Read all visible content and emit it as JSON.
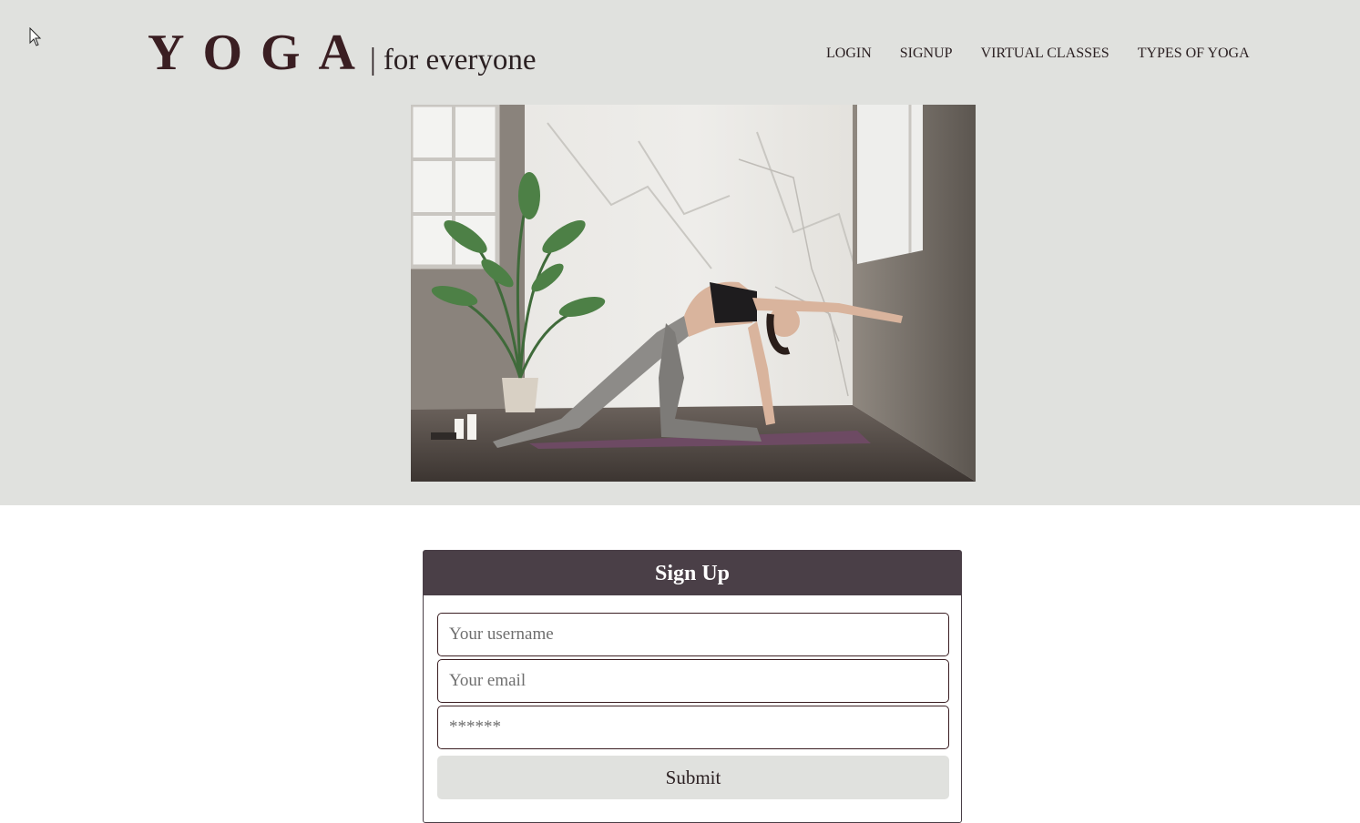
{
  "brand": {
    "name": "YOGA",
    "separator": "|",
    "tagline": "for everyone"
  },
  "nav": {
    "items": [
      {
        "label": "LOGIN"
      },
      {
        "label": "SIGNUP"
      },
      {
        "label": "VIRTUAL CLASSES"
      },
      {
        "label": "TYPES OF YOGA"
      }
    ]
  },
  "hero": {
    "image": "yoga-pose-photo"
  },
  "signup": {
    "title": "Sign Up",
    "username_placeholder": "Your username",
    "email_placeholder": "Your email",
    "password_placeholder": "******",
    "submit_label": "Submit"
  },
  "colors": {
    "hero_background": "#e0e1de",
    "brand_text": "#3a1e22",
    "form_header": "#4a3f47"
  }
}
